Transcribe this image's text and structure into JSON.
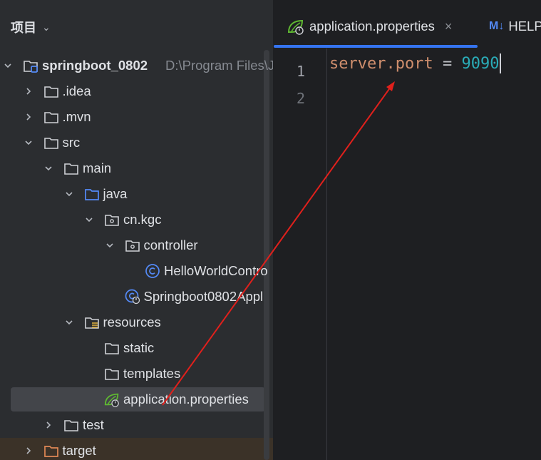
{
  "project_panel": {
    "header_title": "项目",
    "tree": [
      {
        "label": "springboot_0802",
        "hint": "D:\\Program Files\\Je",
        "expanded": true,
        "icon": "module-folder-icon"
      },
      {
        "label": ".idea",
        "expanded": false,
        "icon": "folder-icon"
      },
      {
        "label": ".mvn",
        "expanded": false,
        "icon": "folder-icon"
      },
      {
        "label": "src",
        "expanded": true,
        "icon": "folder-icon"
      },
      {
        "label": "main",
        "expanded": true,
        "icon": "folder-icon"
      },
      {
        "label": "java",
        "expanded": true,
        "icon": "source-folder-icon"
      },
      {
        "label": "cn.kgc",
        "expanded": true,
        "icon": "package-icon"
      },
      {
        "label": "controller",
        "expanded": true,
        "icon": "package-icon"
      },
      {
        "label": "HelloWorldContro",
        "icon": "java-class-icon"
      },
      {
        "label": "Springboot0802Appl",
        "icon": "spring-boot-class-icon"
      },
      {
        "label": "resources",
        "expanded": true,
        "icon": "resources-folder-icon"
      },
      {
        "label": "static",
        "icon": "folder-icon"
      },
      {
        "label": "templates",
        "icon": "folder-icon"
      },
      {
        "label": "application.properties",
        "selected": true,
        "icon": "spring-properties-icon"
      },
      {
        "label": "test",
        "expanded": false,
        "icon": "folder-icon"
      },
      {
        "label": "target",
        "expanded": false,
        "icon": "excluded-folder-icon"
      }
    ]
  },
  "editor": {
    "tabs": [
      {
        "label": "application.properties",
        "active": true,
        "icon": "spring-properties-icon",
        "close": "×"
      },
      {
        "label": "HELP",
        "badge": "M↓",
        "icon": "markdown-icon"
      }
    ],
    "line_numbers": [
      "1",
      "2"
    ],
    "code": {
      "key": "server.port",
      "operator": " = ",
      "value": "9090"
    }
  },
  "colors": {
    "accent": "#3574f0",
    "annotation_arrow": "#e0201c",
    "property_key": "#cf8e6d",
    "property_value": "#2aacb8"
  }
}
